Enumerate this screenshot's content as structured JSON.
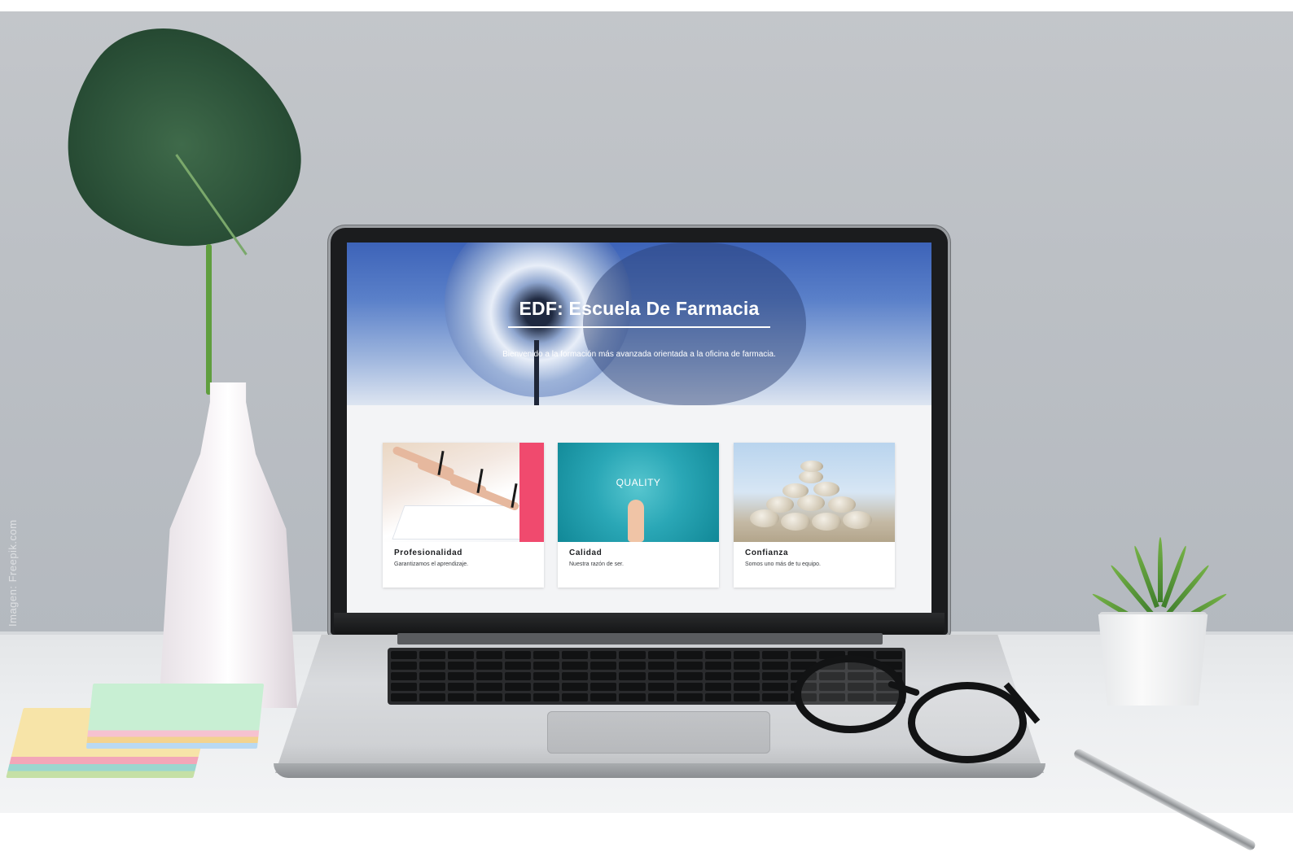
{
  "watermark": "Imagen: Freepik.com",
  "site": {
    "hero": {
      "title": "EDF: Escuela De Farmacia",
      "subtitle": "Bienvenido a la formación más avanzada orientada a la oficina de farmacia."
    },
    "cards": [
      {
        "title": "Profesionalidad",
        "description": "Garantizamos el aprendizaje."
      },
      {
        "title": "Calidad",
        "description": "Nuestra razón de ser.",
        "image_text": "QUALITY"
      },
      {
        "title": "Confianza",
        "description": "Somos uno más de tu equipo."
      }
    ]
  }
}
